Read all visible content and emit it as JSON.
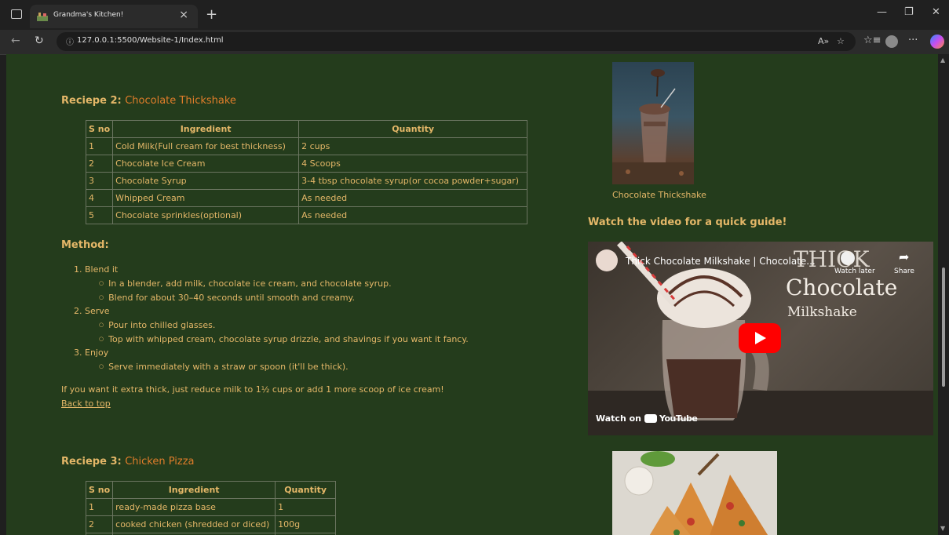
{
  "browser": {
    "tab_title": "Grandma's Kitchen!",
    "url": "127.0.0.1:5500/Website-1/Index.html"
  },
  "recipe2": {
    "prefix": "Reciepe 2:",
    "dish": "Chocolate Thickshake",
    "headers": [
      "S no",
      "Ingredient",
      "Quantity"
    ],
    "rows": [
      [
        "1",
        "Cold Milk(Full cream for best thickness)",
        "2 cups"
      ],
      [
        "2",
        "Chocolate Ice Cream",
        "4 Scoops"
      ],
      [
        "3",
        "Chocolate Syrup",
        "3-4 tbsp chocolate syrup(or cocoa powder+sugar)"
      ],
      [
        "4",
        "Whipped Cream",
        "As needed"
      ],
      [
        "5",
        "Chocolate sprinkles(optional)",
        "As needed"
      ]
    ],
    "method_heading": "Method:",
    "steps": [
      {
        "title": "1. Blend it",
        "subs": [
          "In a blender, add milk, chocolate ice cream, and chocolate syrup.",
          "Blend for about 30–40 seconds until smooth and creamy."
        ]
      },
      {
        "title": "2. Serve",
        "subs": [
          "Pour into chilled glasses.",
          "Top with whipped cream, chocolate syrup drizzle, and shavings if you want it fancy."
        ]
      },
      {
        "title": "3. Enjoy",
        "subs": [
          "Serve immediately with a straw or spoon (it'll be thick)."
        ]
      }
    ],
    "tip": "If you want it extra thick, just reduce milk to 1½ cups or add 1 more scoop of ice cream!",
    "back_to_top": "Back to top",
    "image_caption": "Chocolate Thickshake",
    "video_heading": "Watch the video for a quick guide!",
    "video": {
      "title": "Thick Chocolate Milkshake | Chocolate...",
      "watch_later": "Watch later",
      "share": "Share",
      "overlay_line1": "THICK",
      "overlay_line2": "Chocolate",
      "overlay_line3": "Milkshake",
      "watch_on": "Watch on",
      "youtube": "YouTube"
    }
  },
  "recipe3": {
    "prefix": "Reciepe 3:",
    "dish": "Chicken Pizza",
    "headers": [
      "S no",
      "Ingredient",
      "Quantity"
    ],
    "rows": [
      [
        "1",
        "ready-made pizza base",
        "1"
      ],
      [
        "2",
        "cooked chicken (shredded or diced)",
        "100g"
      ]
    ]
  }
}
